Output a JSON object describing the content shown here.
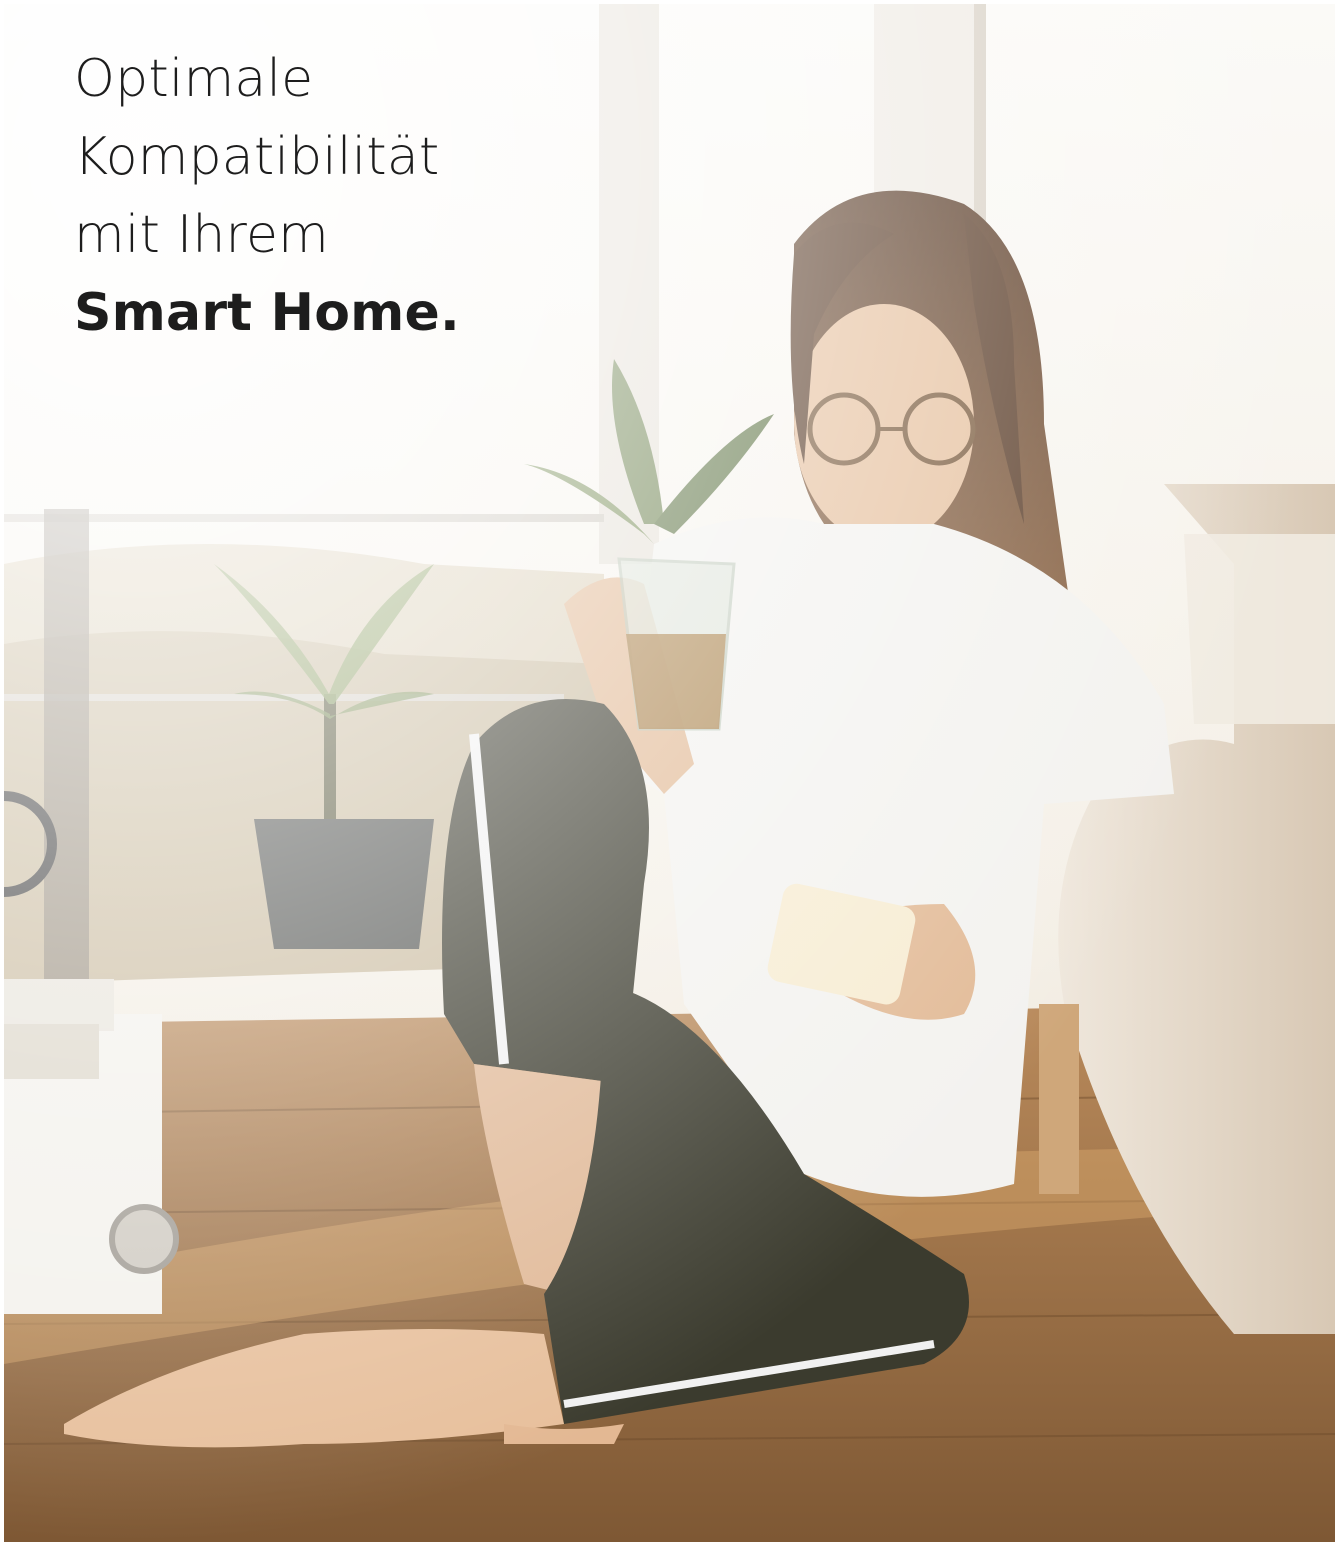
{
  "headline": {
    "line1": "Optimale",
    "line2": "Kompatibilität",
    "line3": "mit Ihrem",
    "line4_bold": "Smart Home."
  },
  "colors": {
    "headline_text": "#1d1d1d",
    "frame": "#ffffff",
    "sky": "#f7f4ee",
    "floor": "#9a6f45",
    "shirt": "#f2f1ee",
    "pants": "#3a3a2c",
    "hair": "#6b4a33",
    "skin": "#e0b896",
    "sofa": "#e6ddd0"
  },
  "photo": {
    "scene": "woman-sitting-on-floor-with-smartphone-and-glass"
  }
}
